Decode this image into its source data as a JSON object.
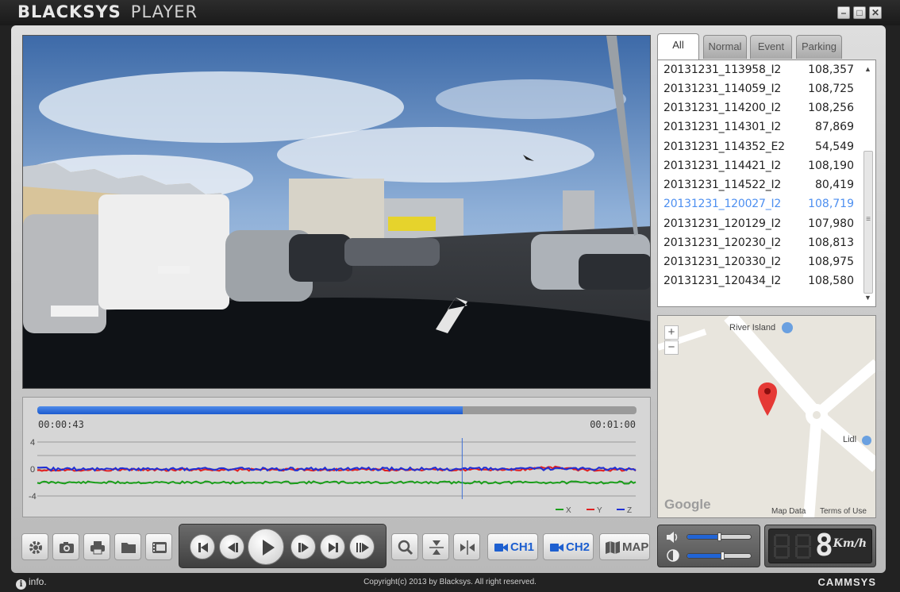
{
  "window": {
    "title_bold": "BLACKSYS",
    "title_light": "PLAYER",
    "controls": [
      "minimize",
      "maximize",
      "close"
    ]
  },
  "playback": {
    "elapsed": "00:00:43",
    "total": "00:01:00",
    "progress_fraction": 0.71
  },
  "gsensor": {
    "y_ticks": [
      "4",
      "0",
      "-4"
    ],
    "legend": [
      {
        "name": "X",
        "color": "#1a9e1a"
      },
      {
        "name": "Y",
        "color": "#e02020"
      },
      {
        "name": "Z",
        "color": "#1f2fd6"
      }
    ],
    "cursor_fraction": 0.71
  },
  "file_tabs": [
    {
      "label": "All",
      "active": true
    },
    {
      "label": "Normal",
      "active": false
    },
    {
      "label": "Event",
      "active": false
    },
    {
      "label": "Parking",
      "active": false
    }
  ],
  "files": [
    {
      "name": "20131231_113958_I2",
      "size": "108,357",
      "selected": false
    },
    {
      "name": "20131231_114059_I2",
      "size": "108,725",
      "selected": false
    },
    {
      "name": "20131231_114200_I2",
      "size": "108,256",
      "selected": false
    },
    {
      "name": "20131231_114301_I2",
      "size": "87,869",
      "selected": false
    },
    {
      "name": "20131231_114352_E2",
      "size": "54,549",
      "selected": false
    },
    {
      "name": "20131231_114421_I2",
      "size": "108,190",
      "selected": false
    },
    {
      "name": "20131231_114522_I2",
      "size": "80,419",
      "selected": false
    },
    {
      "name": "20131231_120027_I2",
      "size": "108,719",
      "selected": true
    },
    {
      "name": "20131231_120129_I2",
      "size": "107,980",
      "selected": false
    },
    {
      "name": "20131231_120230_I2",
      "size": "108,813",
      "selected": false
    },
    {
      "name": "20131231_120330_I2",
      "size": "108,975",
      "selected": false
    },
    {
      "name": "20131231_120434_I2",
      "size": "108,580",
      "selected": false
    }
  ],
  "map": {
    "zoom_in": "+",
    "zoom_out": "−",
    "place_1": "River Island",
    "place_2": "Lidl",
    "google": "Google",
    "map_data": "Map Data",
    "terms": "Terms of Use"
  },
  "toolbar": {
    "left_icons": [
      "gear-icon",
      "camera-icon",
      "printer-icon",
      "folder-icon",
      "film-icon"
    ],
    "player_icons": [
      "skip-previous-icon",
      "step-back-icon",
      "play-icon",
      "step-forward-icon",
      "skip-next-icon",
      "frame-advance-icon"
    ],
    "tool_icons": [
      "magnifier-icon",
      "flip-vertical-icon",
      "flip-horizontal-icon"
    ],
    "ch1_label": "CH1",
    "ch2_label": "CH2",
    "map_label": "MAP"
  },
  "audio": {
    "volume_level": 0.5,
    "brightness_level": 0.55
  },
  "speed": {
    "value": "8",
    "unit": "Km/h"
  },
  "status": {
    "info": "info.",
    "copyright": "Copyright(c) 2013 by Blacksys. All right reserved.",
    "brand": "CAMMSYS"
  },
  "colors": {
    "accent_blue": "#1d5fd0",
    "selected_file": "#4d8ff0"
  }
}
